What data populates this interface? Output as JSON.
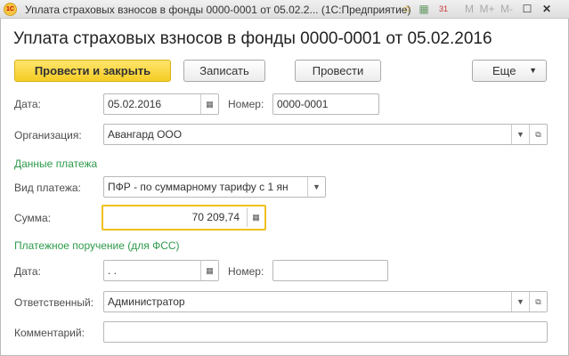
{
  "window": {
    "title": "Уплата страховых взносов в фонды 0000-0001 от 05.02.2... (1С:Предприятие)",
    "logo": "1С",
    "buttons": [
      "M",
      "M+",
      "M-"
    ]
  },
  "form": {
    "title": "Уплата страховых взносов в фонды 0000-0001 от 05.02.2016"
  },
  "toolbar": {
    "post_close": "Провести и закрыть",
    "save": "Записать",
    "post": "Провести",
    "more": "Еще"
  },
  "fields": {
    "date_label": "Дата:",
    "date": "05.02.2016",
    "number_label": "Номер:",
    "number": "0000-0001",
    "org_label": "Организация:",
    "org": "Авангард ООО",
    "payment_group": "Данные платежа",
    "ptype_label": "Вид платежа:",
    "ptype": "ПФР - по суммарному тарифу с 1 ян",
    "sum_label": "Сумма:",
    "sum": "70 209,74",
    "order_group": "Платежное поручение (для ФСС)",
    "odate_label": "Дата:",
    "odate": " .  .",
    "onum_label": "Номер:",
    "onum": "",
    "resp_label": "Ответственный:",
    "resp": "Администратор",
    "comment_label": "Комментарий:",
    "comment": ""
  },
  "colors": {
    "accent": "#f5cc24",
    "group": "#2d9a4a",
    "focus": "#f0c020"
  }
}
